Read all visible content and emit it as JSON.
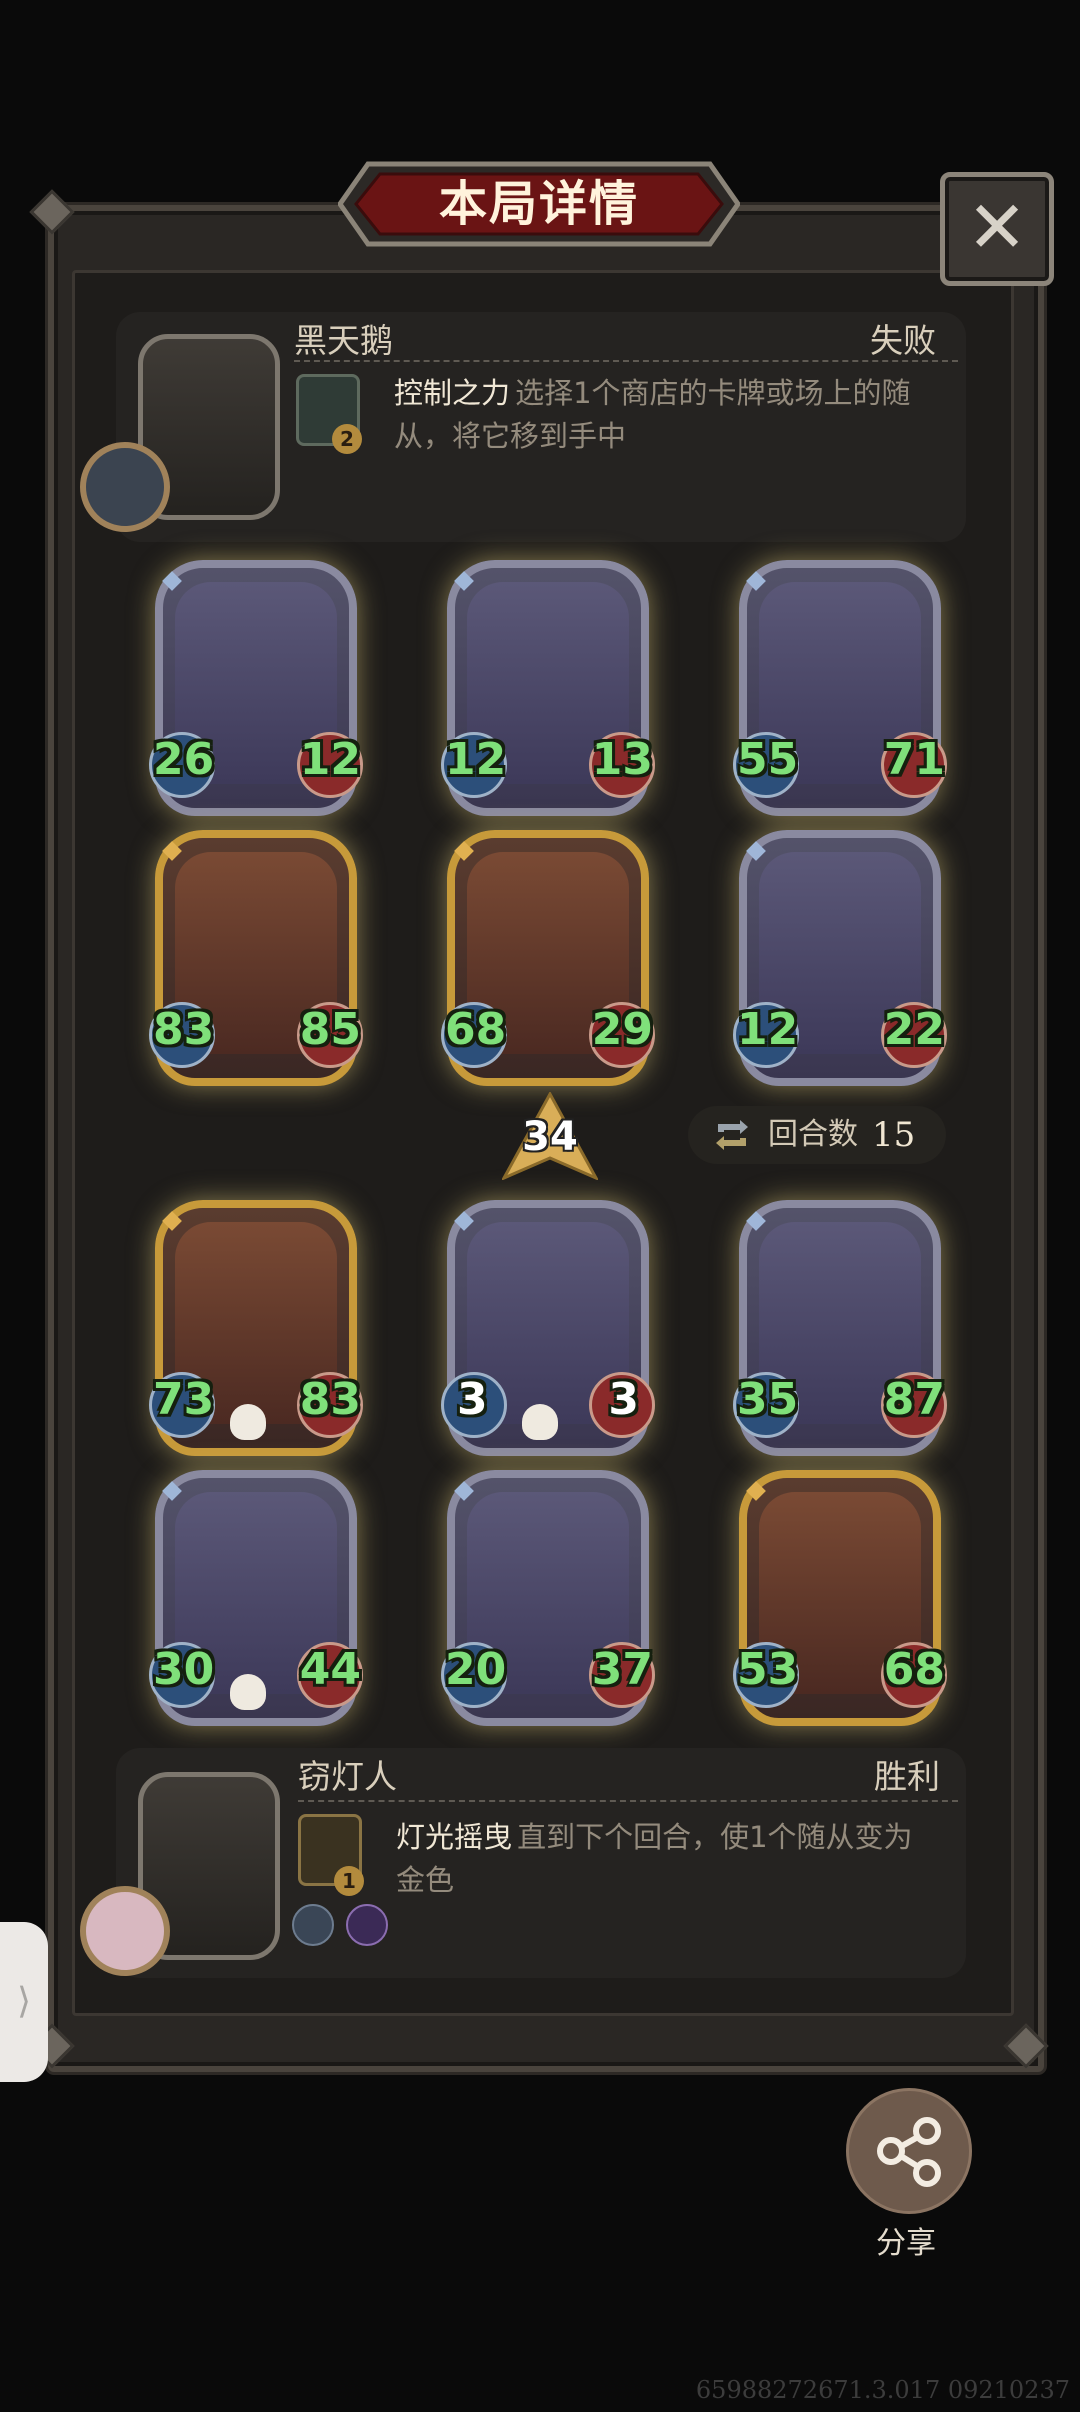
{
  "title": "本局详情",
  "close_icon": "close-x-icon",
  "player_top": {
    "name": "黑天鹅",
    "result": "失败",
    "skill_name": "控制之力",
    "skill_desc": "选择1个商店的卡牌或场上的随从，将它移到手中",
    "skill_cost": "2"
  },
  "player_bottom": {
    "name": "窃灯人",
    "result": "胜利",
    "skill_name": "灯光摇曳",
    "skill_desc": "直到下个回合，使1个随从变为金色",
    "skill_cost": "1"
  },
  "top_board": [
    {
      "attack": "26",
      "health": "12",
      "frame": "silver"
    },
    {
      "attack": "12",
      "health": "13",
      "frame": "silver"
    },
    {
      "attack": "55",
      "health": "71",
      "frame": "silver"
    },
    {
      "attack": "83",
      "health": "85",
      "frame": "gold"
    },
    {
      "attack": "68",
      "health": "29",
      "frame": "gold"
    },
    {
      "attack": "12",
      "health": "22",
      "frame": "silver"
    }
  ],
  "bottom_board": [
    {
      "attack": "73",
      "health": "83",
      "frame": "gold",
      "skull": true
    },
    {
      "attack": "3",
      "health": "3",
      "frame": "silver",
      "skull": true
    },
    {
      "attack": "35",
      "health": "87",
      "frame": "silver",
      "skull": false
    },
    {
      "attack": "30",
      "health": "44",
      "frame": "silver",
      "skull": true
    },
    {
      "attack": "20",
      "health": "37",
      "frame": "silver",
      "skull": false
    },
    {
      "attack": "53",
      "health": "68",
      "frame": "gold",
      "skull": false
    }
  ],
  "tier": "34",
  "rounds": {
    "label": "回合数",
    "value": "15"
  },
  "share": {
    "label": "分享",
    "icon": "share-icon"
  },
  "side_handle": "⟩",
  "watermark": "65988272671.3.017 09210237",
  "colors": {
    "stat_green": "#7fe07a",
    "gold_frame": "#c79a3a",
    "silver_frame": "#8a8aa0",
    "panel": "#252321"
  }
}
